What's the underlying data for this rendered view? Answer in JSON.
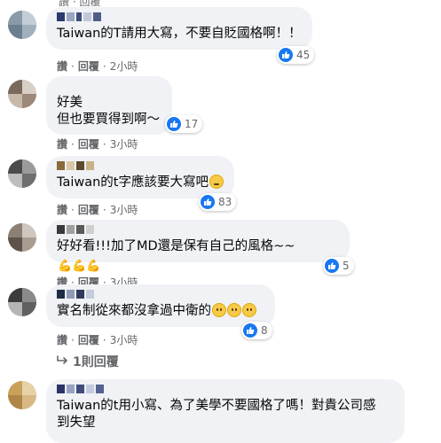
{
  "top_actions": "讚 · 回覆 · ...",
  "common": {
    "like": "讚",
    "reply": "回覆",
    "dot": "·"
  },
  "comments": [
    {
      "text": "Taiwan的T請用大寫，不要自貶國格啊！！",
      "time": "2小時",
      "reactions": "45"
    },
    {
      "text": "好美\n但也要買得到啊～",
      "time": "3小時",
      "reactions": "17"
    },
    {
      "text": "Taiwan的t字應該要大寫吧",
      "time": "3小時",
      "reactions": "83"
    },
    {
      "text": "好好看!!!加了MD還是保有自己的風格~~",
      "time": "3小時",
      "reactions": "5"
    },
    {
      "text": "實名制從來都沒拿過中衛的",
      "time": "3小時",
      "reactions": "8"
    },
    {
      "text": "Taiwan的t用小寫、為了美學不要國格了嗎！對貴公司感\n到失望",
      "time": "",
      "reactions": ""
    }
  ],
  "replies_label": "1則回覆",
  "colors": {
    "accent": "#1877f2",
    "bubble": "#f0f2f5",
    "meta": "#65676b"
  }
}
